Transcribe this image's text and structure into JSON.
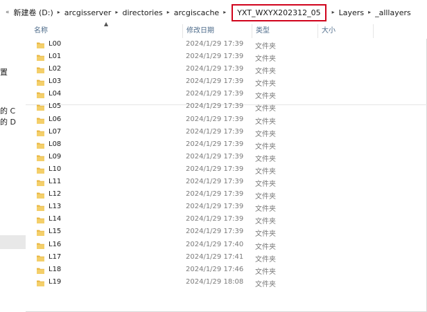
{
  "breadcrumb": {
    "lead_glyph": "«",
    "separator_glyph": "▸",
    "items": [
      "新建卷 (D:)",
      "arcgisserver",
      "directories",
      "arcgiscache",
      "YXT_WXYX202312_05",
      "Layers",
      "_alllayers"
    ]
  },
  "left_pane": {
    "items": [
      "置",
      "的 C",
      "的 D"
    ]
  },
  "columns": {
    "name": "名称",
    "modified": "修改日期",
    "type": "类型",
    "size": "大小"
  },
  "colors": {
    "highlight_border": "#d0021b",
    "folder": "#e8b642",
    "header_text": "#4d6b8a"
  },
  "rows": [
    {
      "name": "L00",
      "date": "2024/1/29 17:39",
      "type": "文件夹"
    },
    {
      "name": "L01",
      "date": "2024/1/29 17:39",
      "type": "文件夹"
    },
    {
      "name": "L02",
      "date": "2024/1/29 17:39",
      "type": "文件夹"
    },
    {
      "name": "L03",
      "date": "2024/1/29 17:39",
      "type": "文件夹"
    },
    {
      "name": "L04",
      "date": "2024/1/29 17:39",
      "type": "文件夹"
    },
    {
      "name": "L05",
      "date": "2024/1/29 17:39",
      "type": "文件夹"
    },
    {
      "name": "L06",
      "date": "2024/1/29 17:39",
      "type": "文件夹"
    },
    {
      "name": "L07",
      "date": "2024/1/29 17:39",
      "type": "文件夹"
    },
    {
      "name": "L08",
      "date": "2024/1/29 17:39",
      "type": "文件夹"
    },
    {
      "name": "L09",
      "date": "2024/1/29 17:39",
      "type": "文件夹"
    },
    {
      "name": "L10",
      "date": "2024/1/29 17:39",
      "type": "文件夹"
    },
    {
      "name": "L11",
      "date": "2024/1/29 17:39",
      "type": "文件夹"
    },
    {
      "name": "L12",
      "date": "2024/1/29 17:39",
      "type": "文件夹"
    },
    {
      "name": "L13",
      "date": "2024/1/29 17:39",
      "type": "文件夹"
    },
    {
      "name": "L14",
      "date": "2024/1/29 17:39",
      "type": "文件夹"
    },
    {
      "name": "L15",
      "date": "2024/1/29 17:39",
      "type": "文件夹"
    },
    {
      "name": "L16",
      "date": "2024/1/29 17:40",
      "type": "文件夹"
    },
    {
      "name": "L17",
      "date": "2024/1/29 17:41",
      "type": "文件夹"
    },
    {
      "name": "L18",
      "date": "2024/1/29 17:46",
      "type": "文件夹"
    },
    {
      "name": "L19",
      "date": "2024/1/29 18:08",
      "type": "文件夹"
    }
  ]
}
